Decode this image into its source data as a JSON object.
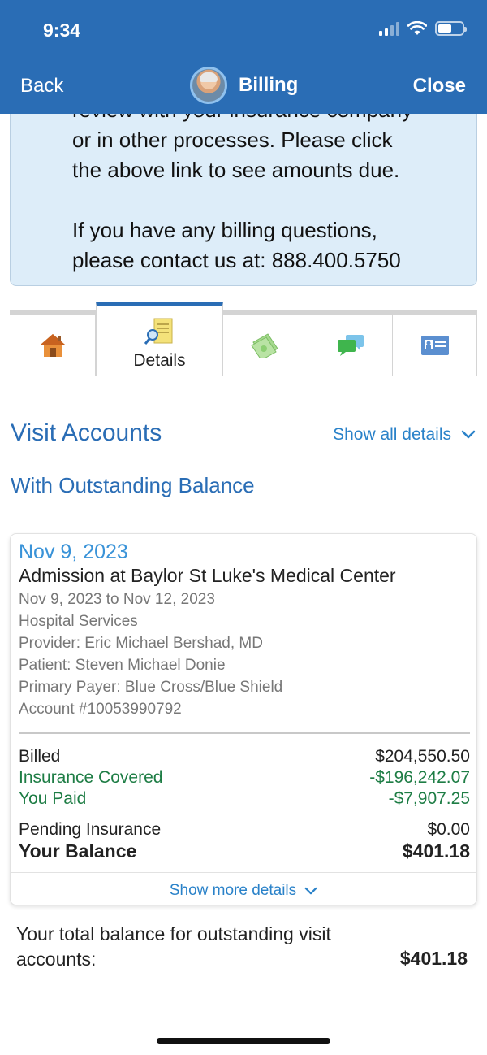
{
  "status_bar": {
    "time": "9:34"
  },
  "nav": {
    "back": "Back",
    "title": "Billing",
    "close": "Close"
  },
  "info": {
    "lines": [
      "review with your insurance company",
      "or in other processes. Please click",
      "the above link to see amounts due."
    ],
    "contact_lines": [
      "If you have any billing questions,",
      "please contact us at: 888.400.5750"
    ]
  },
  "tabs": [
    {
      "icon": "home-icon"
    },
    {
      "icon": "details-icon",
      "label": "Details",
      "active": true
    },
    {
      "icon": "money-icon"
    },
    {
      "icon": "messages-icon"
    },
    {
      "icon": "id-card-icon"
    }
  ],
  "section": {
    "title": "Visit Accounts",
    "show_all": "Show all details",
    "subtitle": "With Outstanding Balance"
  },
  "account": {
    "date": "Nov 9, 2023",
    "title": "Admission at Baylor St Luke's Medical Center",
    "details": [
      "Nov 9, 2023 to Nov 12, 2023",
      "Hospital Services",
      "Provider: Eric Michael Bershad, MD",
      "Patient: Steven Michael Donie",
      "Primary Payer: Blue Cross/Blue Shield",
      "Account #10053990792"
    ],
    "billed": {
      "label": "Billed",
      "value": "$204,550.50"
    },
    "insurance_covered": {
      "label": "Insurance Covered",
      "value": "-$196,242.07"
    },
    "you_paid": {
      "label": "You Paid",
      "value": "-$7,907.25"
    },
    "pending_insurance": {
      "label": "Pending Insurance",
      "value": "$0.00"
    },
    "your_balance": {
      "label": "Your Balance",
      "value": "$401.18"
    },
    "show_more": "Show more details"
  },
  "total": {
    "label": "Your total balance for outstanding visit accounts:",
    "value": "$401.18"
  },
  "colors": {
    "header": "#2a6db5",
    "info_bg": "#ddedf9",
    "link": "#2a82c9",
    "green": "#1e7d45"
  }
}
